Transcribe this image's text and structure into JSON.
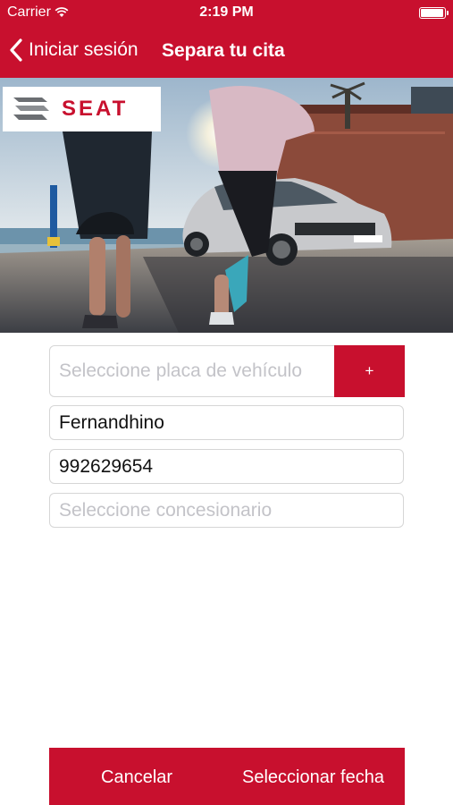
{
  "status_bar": {
    "carrier": "Carrier",
    "time": "2:19 PM",
    "battery_level": 0.95
  },
  "nav": {
    "back_label": "Iniciar sesión",
    "title": "Separa tu cita"
  },
  "hero": {
    "brand": "SEAT",
    "license_plate": "1001 LYC"
  },
  "form": {
    "plate_placeholder": "Seleccione placa de vehículo",
    "add_label": "+",
    "name_value": "Fernandhino",
    "phone_value": "992629654",
    "dealer_placeholder": "Seleccione concesionario"
  },
  "actions": {
    "cancel_label": "Cancelar",
    "select_date_label": "Seleccionar fecha"
  },
  "colors": {
    "brand_red": "#c8102e",
    "placeholder_gray": "#c3c3c8"
  }
}
